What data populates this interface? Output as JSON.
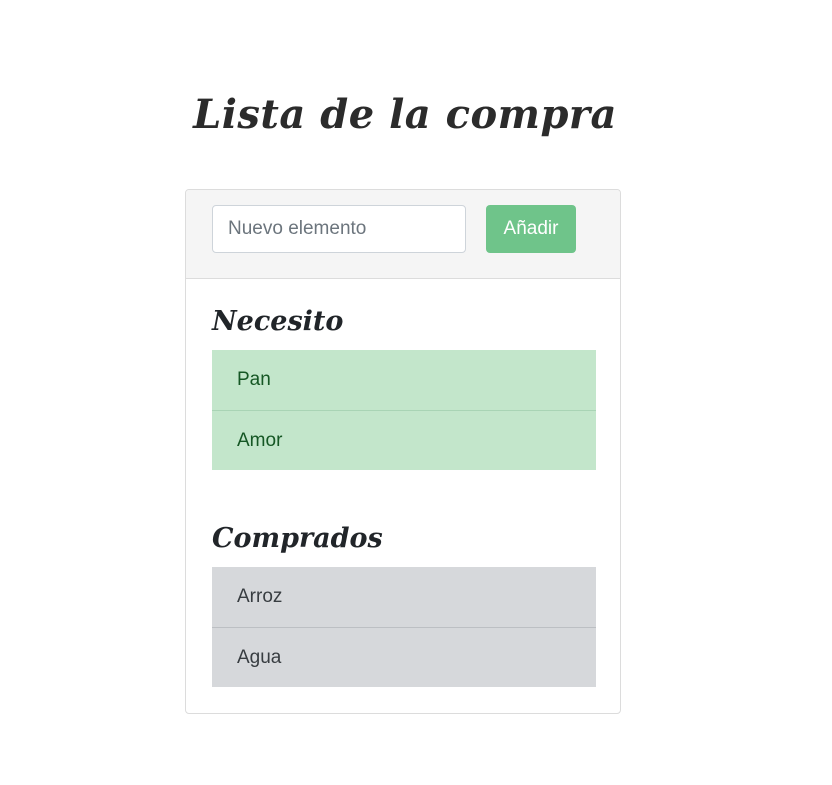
{
  "page": {
    "title": "Lista de la compra"
  },
  "form": {
    "input_placeholder": "Nuevo elemento",
    "input_value": "",
    "add_label": "Añadir"
  },
  "needed": {
    "title": "Necesito",
    "items": [
      {
        "label": "Pan"
      },
      {
        "label": "Amor"
      }
    ]
  },
  "bought": {
    "title": "Comprados",
    "items": [
      {
        "label": "Arroz"
      },
      {
        "label": "Agua"
      }
    ]
  },
  "colors": {
    "add_button": "#6fc48a",
    "needed_item_bg": "#c3e6cb",
    "needed_item_text": "#155724",
    "bought_item_bg": "#d6d8db",
    "bought_item_text": "#383d41",
    "header_bg": "#f5f5f5"
  }
}
